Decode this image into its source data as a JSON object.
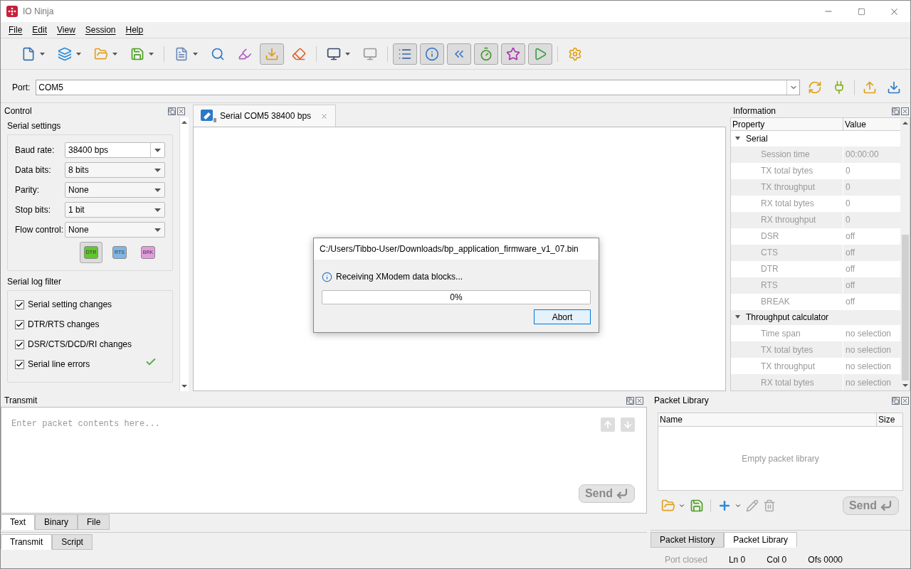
{
  "window": {
    "title": "IO Ninja"
  },
  "menu": [
    "File",
    "Edit",
    "View",
    "Session",
    "Help"
  ],
  "toolbar": [
    {
      "kind": "button",
      "dropdown": true,
      "pressed": false
    },
    {
      "kind": "button",
      "dropdown": true,
      "pressed": false
    },
    {
      "kind": "button",
      "dropdown": true,
      "pressed": false
    },
    {
      "kind": "button",
      "dropdown": true,
      "pressed": false
    },
    {
      "kind": "separator"
    },
    {
      "kind": "button",
      "dropdown": true,
      "pressed": false
    },
    {
      "kind": "button",
      "dropdown": false,
      "pressed": false
    },
    {
      "kind": "button",
      "dropdown": false,
      "pressed": false
    },
    {
      "kind": "button",
      "dropdown": false,
      "pressed": true
    },
    {
      "kind": "button",
      "dropdown": false,
      "pressed": false
    },
    {
      "kind": "separator"
    },
    {
      "kind": "button",
      "dropdown": true,
      "pressed": false
    },
    {
      "kind": "button",
      "dropdown": false,
      "pressed": false
    },
    {
      "kind": "separator"
    },
    {
      "kind": "button",
      "dropdown": false,
      "pressed": true
    },
    {
      "kind": "button",
      "dropdown": false,
      "pressed": true
    },
    {
      "kind": "button",
      "dropdown": false,
      "pressed": true
    },
    {
      "kind": "button",
      "dropdown": false,
      "pressed": true
    },
    {
      "kind": "button",
      "dropdown": false,
      "pressed": true
    },
    {
      "kind": "button",
      "dropdown": false,
      "pressed": true
    },
    {
      "kind": "separator"
    },
    {
      "kind": "button",
      "dropdown": false,
      "pressed": false
    }
  ],
  "port_bar": {
    "label": "Port:",
    "value": "COM5"
  },
  "control": {
    "title": "Control",
    "serial_settings": {
      "title": "Serial settings",
      "fields": [
        {
          "label": "Baud rate:",
          "value": "38400 bps",
          "kind": "editable"
        },
        {
          "label": "Data bits:",
          "value": "8 bits",
          "kind": "select"
        },
        {
          "label": "Parity:",
          "value": "None",
          "kind": "select"
        },
        {
          "label": "Stop bits:",
          "value": "1 bit",
          "kind": "select"
        },
        {
          "label": "Flow control:",
          "value": "None",
          "kind": "select"
        }
      ],
      "line_buttons": [
        {
          "label": "DTR",
          "pressed": true,
          "color": "#5fc82a"
        },
        {
          "label": "RTS",
          "pressed": false,
          "color": "#7fb6e6"
        },
        {
          "label": "BRK",
          "pressed": false,
          "color": "#e59ae0"
        }
      ]
    },
    "log_filter": {
      "title": "Serial log filter",
      "items": [
        {
          "label": "Serial setting changes",
          "checked": true
        },
        {
          "label": "DTR/RTS changes",
          "checked": true
        },
        {
          "label": "DSR/CTS/DCD/RI changes",
          "checked": true
        },
        {
          "label": "Serial line errors",
          "checked": true
        }
      ]
    }
  },
  "session_tabs": [
    {
      "label": "Serial COM5 38400 bps",
      "selected": true
    }
  ],
  "dialog": {
    "title": "C:/Users/Tibbo-User/Downloads/bp_application_firmware_v1_07.bin",
    "message": "Receiving XModem data blocks...",
    "progress": {
      "level": 0,
      "reading": "0%"
    },
    "button": "Abort"
  },
  "information": {
    "title": "Information",
    "columns": [
      "Property",
      "Value"
    ],
    "groups": [
      {
        "name": "Serial",
        "expanded": true,
        "children": [
          {
            "property": "Session time",
            "value": "00:00:00",
            "disabled": true
          },
          {
            "property": "TX total bytes",
            "value": "0",
            "disabled": true
          },
          {
            "property": "TX throughput",
            "value": "0",
            "disabled": true
          },
          {
            "property": "RX total bytes",
            "value": "0",
            "disabled": true
          },
          {
            "property": "RX throughput",
            "value": "0",
            "disabled": true
          },
          {
            "property": "DSR",
            "value": "off",
            "disabled": true
          },
          {
            "property": "CTS",
            "value": "off",
            "disabled": true
          },
          {
            "property": "DTR",
            "value": "off",
            "disabled": true
          },
          {
            "property": "RTS",
            "value": "off",
            "disabled": true
          },
          {
            "property": "BREAK",
            "value": "off",
            "disabled": true
          }
        ]
      },
      {
        "name": "Throughput calculator",
        "expanded": true,
        "children": [
          {
            "property": "Time span",
            "value": "no selection",
            "disabled": true
          },
          {
            "property": "TX total bytes",
            "value": "no selection",
            "disabled": true
          },
          {
            "property": "TX throughput",
            "value": "no selection",
            "disabled": true
          },
          {
            "property": "RX total bytes",
            "value": "no selection",
            "disabled": true
          }
        ]
      }
    ]
  },
  "transmit": {
    "title": "Transmit",
    "placeholder": "Enter packet contents here...",
    "send": {
      "label": "Send",
      "disabled": true
    },
    "mode_tabs": [
      {
        "label": "Text",
        "selected": true
      },
      {
        "label": "Binary",
        "selected": false
      },
      {
        "label": "File",
        "selected": false
      }
    ],
    "tabs": [
      {
        "label": "Transmit",
        "selected": true
      },
      {
        "label": "Script",
        "selected": false
      }
    ]
  },
  "packet_library": {
    "title": "Packet Library",
    "columns": [
      "Name",
      "Size"
    ],
    "empty_text": "Empty packet library",
    "send": {
      "label": "Send",
      "disabled": true
    },
    "tabs": [
      {
        "label": "Packet History",
        "selected": false
      },
      {
        "label": "Packet Library",
        "selected": true
      }
    ]
  },
  "status_bar": [
    {
      "text": "Port closed",
      "disabled": true
    },
    {
      "text": "Ln 0",
      "disabled": false
    },
    {
      "text": "Col 0",
      "disabled": false
    },
    {
      "text": "Ofs 0000",
      "disabled": false
    }
  ]
}
